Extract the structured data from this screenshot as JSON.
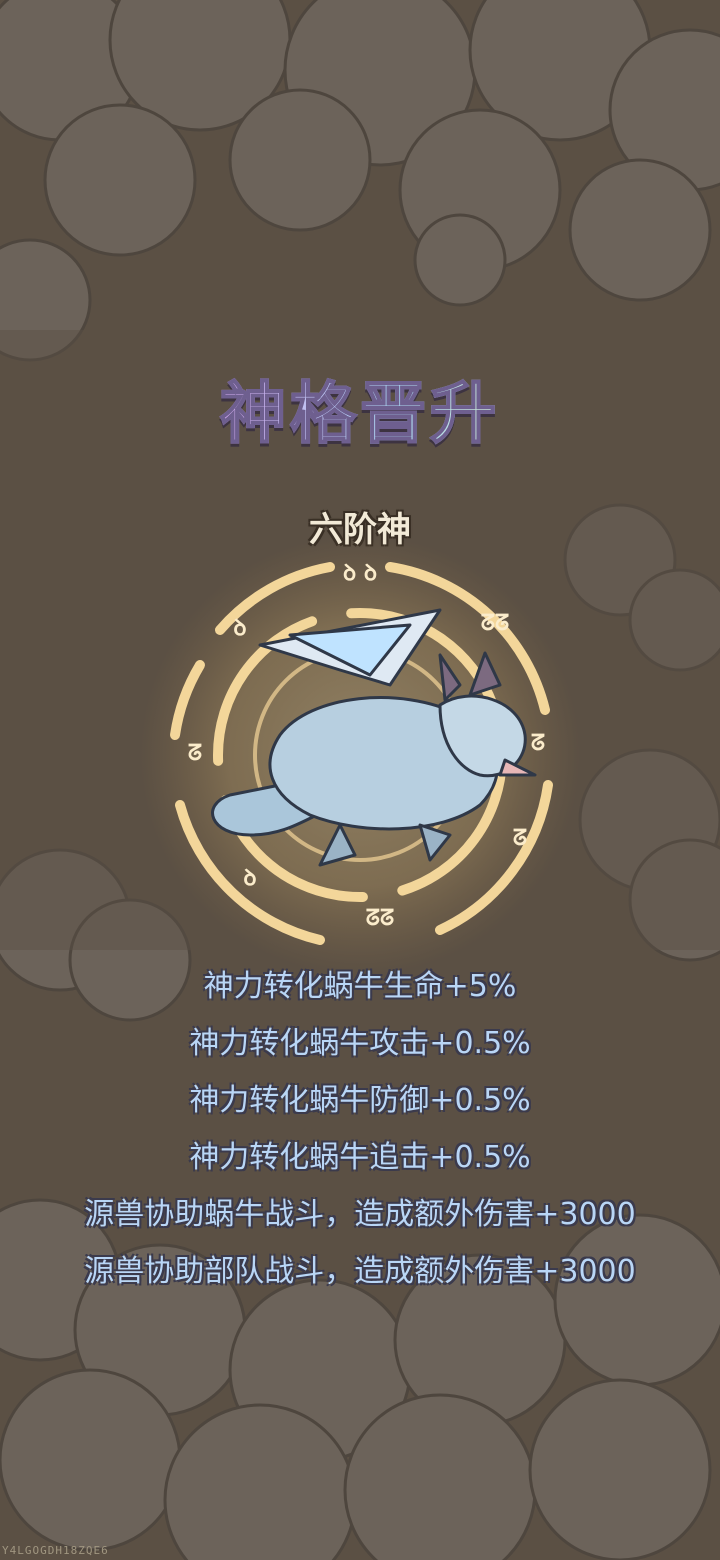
{
  "title": "神格晋升",
  "rank": "六阶神",
  "bonuses": [
    "神力转化蜗牛生命+5%",
    "神力转化蜗牛攻击+0.5%",
    "神力转化蜗牛防御+0.5%",
    "神力转化蜗牛追击+0.5%",
    "源兽协助蜗牛战斗，造成额外伤害+3000",
    "源兽协助部队战斗，造成额外伤害+3000"
  ],
  "watermark": "Y4LGOGDH18ZQE6",
  "icons": {
    "emblem": "rune-circle-icon",
    "creature": "ice-dragon-icon"
  },
  "colors": {
    "background": "#5b5044",
    "cloud": "#6e655c",
    "glow": "#f7dfa3",
    "bonus_text": "#b9d6f6"
  }
}
